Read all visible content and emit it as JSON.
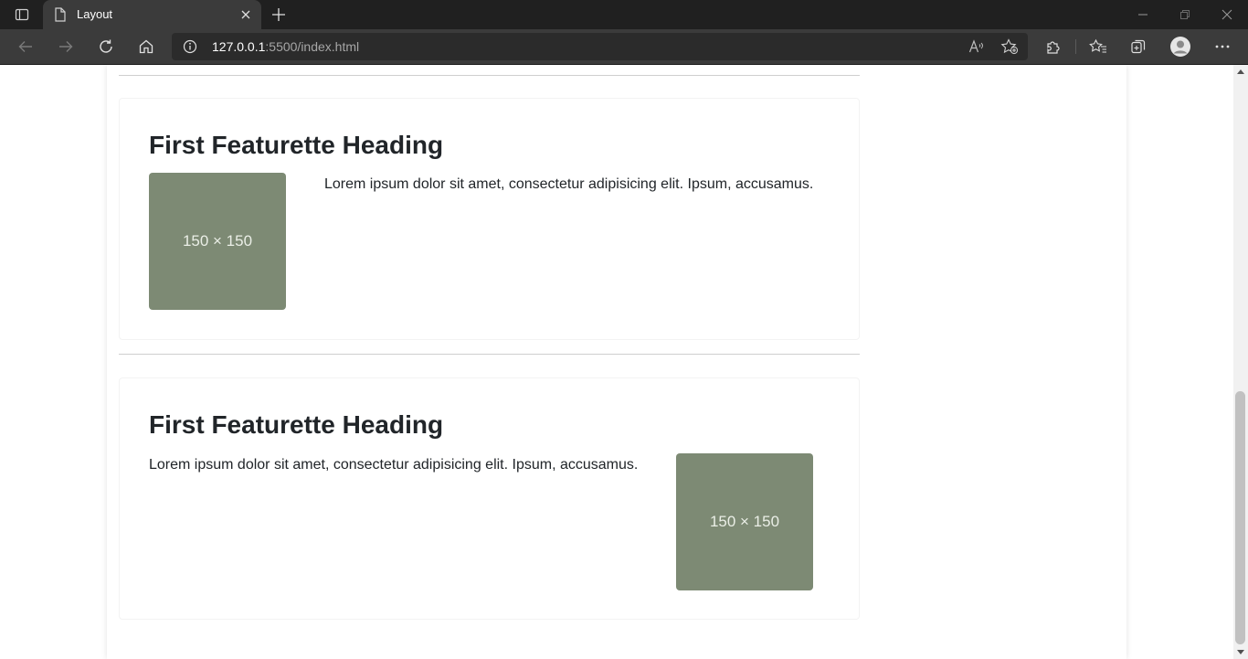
{
  "browser": {
    "tab_title": "Layout",
    "url_host": "127.0.0.1",
    "url_rest": ":5500/index.html",
    "icons": [
      "tab-actions-icon",
      "document-icon",
      "close-icon",
      "plus-icon",
      "minimize-icon",
      "restore-icon",
      "window-close-icon",
      "back-arrow-icon",
      "forward-arrow-icon",
      "reload-icon",
      "home-icon",
      "info-icon",
      "read-aloud-icon",
      "add-favorite-icon",
      "extensions-icon",
      "favorites-icon",
      "collections-icon",
      "profile-avatar-icon",
      "more-icon"
    ]
  },
  "features": [
    {
      "heading": "First Featurette Heading",
      "text": "Lorem ipsum dolor sit amet, consectetur adipisicing elit. Ipsum, accusamus.",
      "image_label": "150 × 150",
      "image_side": "left"
    },
    {
      "heading": "First Featurette Heading",
      "text": "Lorem ipsum dolor sit amet, consectetur adipisicing elit. Ipsum, accusamus.",
      "image_label": "150 × 150",
      "image_side": "right"
    }
  ],
  "colors": {
    "placeholder_bg": "#7d8a74",
    "chrome_dark": "#202020",
    "toolbar": "#3b3b3b"
  }
}
